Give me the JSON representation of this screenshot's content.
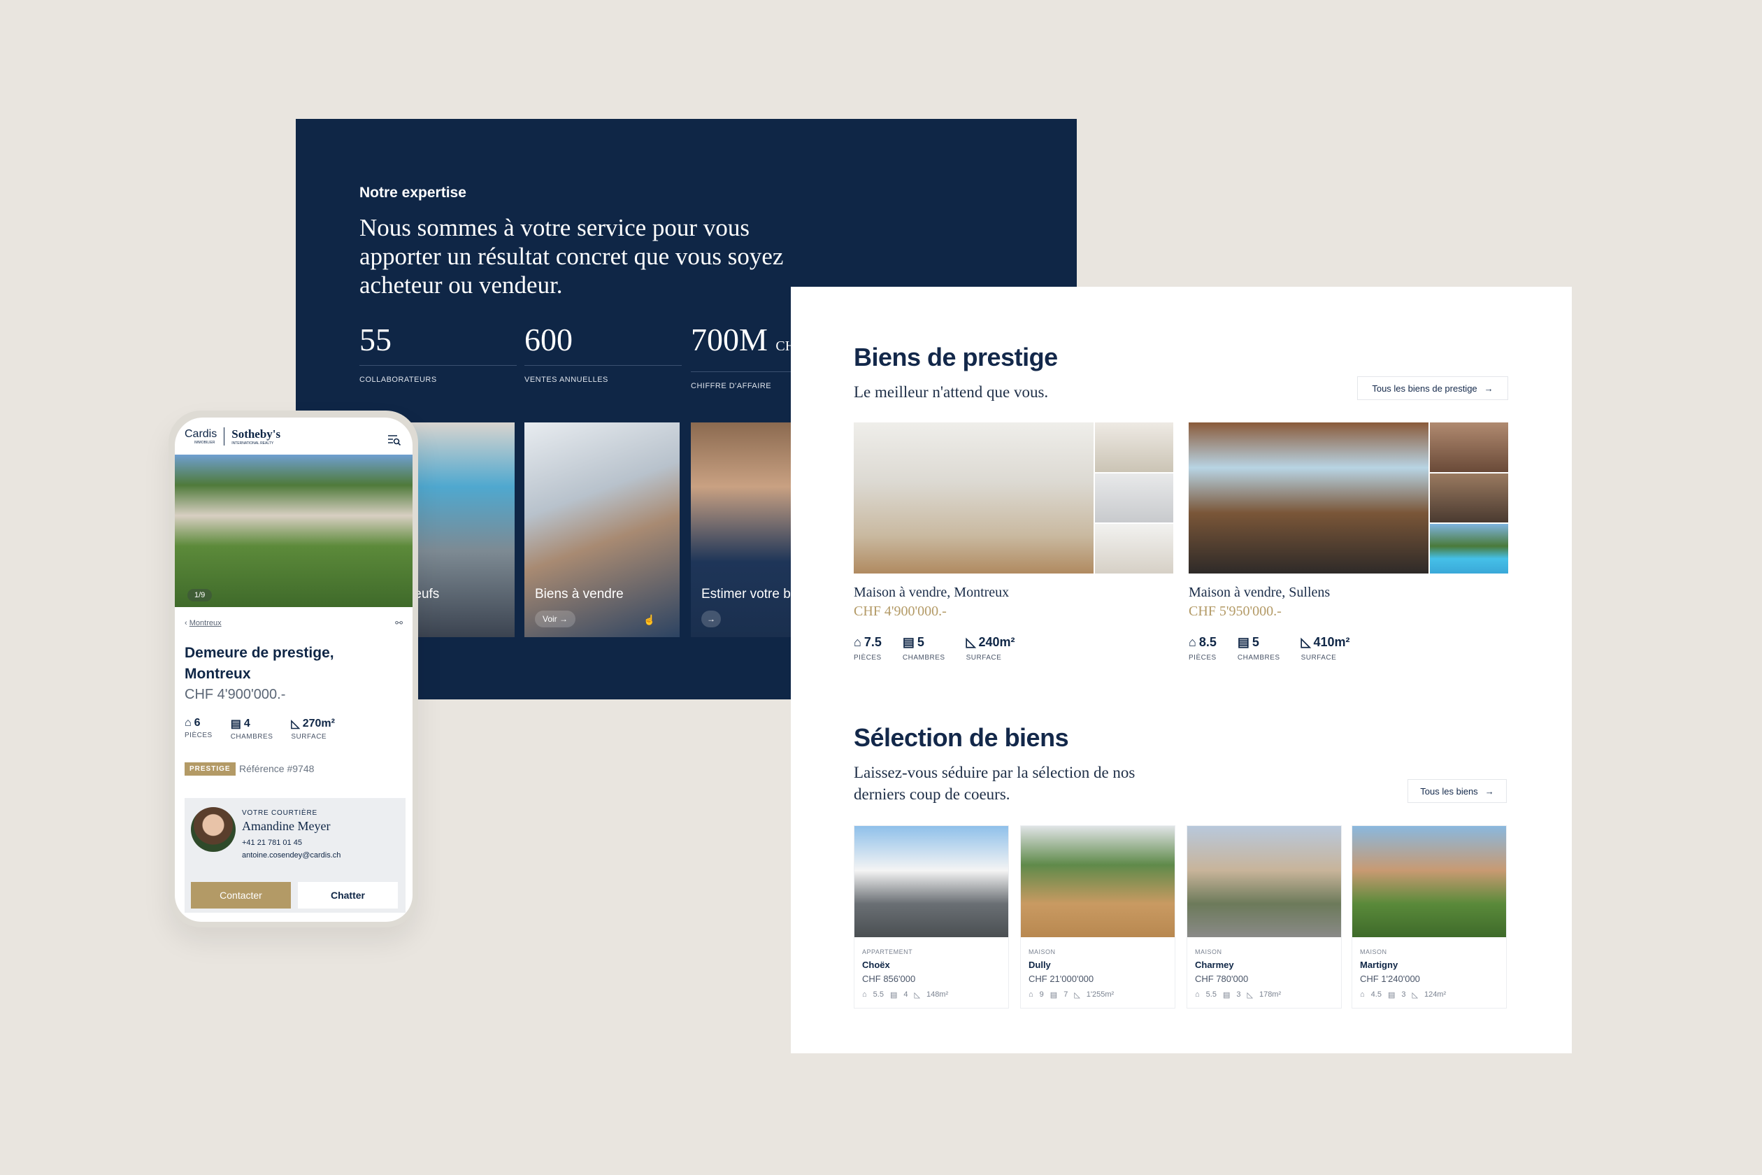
{
  "expertise": {
    "eyebrow": "Notre expertise",
    "heading": "Nous sommes à votre service pour vous apporter un résultat concret que vous soyez acheteur ou vendeur.",
    "stats": [
      {
        "value": "55",
        "unit": "",
        "label": "COLLABORATEURS"
      },
      {
        "value": "600",
        "unit": "",
        "label": "VENTES ANNUELLES"
      },
      {
        "value": "700M",
        "unit": "CHF",
        "label": "CHIFFRE D'AFFAIRE"
      }
    ],
    "services": [
      {
        "title": "Biens neufs",
        "button": ""
      },
      {
        "title": "Biens à vendre",
        "button": "Voir →"
      },
      {
        "title": "Estimer votre bien",
        "button": "→"
      }
    ]
  },
  "prestige": {
    "title": "Biens de prestige",
    "subtitle": "Le meilleur n'attend que vous.",
    "button": "Tous les biens de prestige",
    "items": [
      {
        "title": "Maison à vendre, Montreux",
        "price": "CHF 4'900'000.-",
        "rooms": "7.5",
        "bedrooms": "5",
        "surface": "240m²"
      },
      {
        "title": "Maison à vendre, Sullens",
        "price": "CHF 5'950'000.-",
        "rooms": "8.5",
        "bedrooms": "5",
        "surface": "410m²"
      }
    ],
    "labels": {
      "rooms": "PIÈCES",
      "bedrooms": "CHAMBRES",
      "surface": "SURFACE"
    }
  },
  "selection": {
    "title": "Sélection de biens",
    "subtitle_line1": "Laissez-vous séduire par la sélection de nos",
    "subtitle_line2": "derniers coup de coeurs.",
    "button": "Tous les biens",
    "items": [
      {
        "type": "APPARTEMENT",
        "name": "Choëx",
        "price": "CHF 856'000",
        "rooms": "5.5",
        "bedrooms": "4",
        "surface": "148m²"
      },
      {
        "type": "MAISON",
        "name": "Dully",
        "price": "CHF 21'000'000",
        "rooms": "9",
        "bedrooms": "7",
        "surface": "1'255m²"
      },
      {
        "type": "MAISON",
        "name": "Charmey",
        "price": "CHF 780'000",
        "rooms": "5.5",
        "bedrooms": "3",
        "surface": "178m²"
      },
      {
        "type": "MAISON",
        "name": "Martigny",
        "price": "CHF 1'240'000",
        "rooms": "4.5",
        "bedrooms": "3",
        "surface": "124m²"
      }
    ]
  },
  "mobile": {
    "logo_left": "Cardis",
    "logo_left_sub": "IMMOBILIER",
    "logo_right": "Sotheby's",
    "logo_right_sub": "INTERNATIONAL REALTY",
    "photo_counter": "1/9",
    "breadcrumb": "Montreux",
    "title_line1": "Demeure de prestige,",
    "title_line2": "Montreux",
    "price": "CHF 4'900'000.-",
    "rooms": "6",
    "bedrooms": "4",
    "surface": "270m²",
    "labels": {
      "rooms": "PIÈCES",
      "bedrooms": "CHAMBRES",
      "surface": "SURFACE"
    },
    "badge": "PRESTIGE",
    "reference": "Référence #9748",
    "agent": {
      "role": "VOTRE COURTIÈRE",
      "name": "Amandine Meyer",
      "phone": "+41 21 781 01 45",
      "email": "antoine.cosendey@cardis.ch"
    },
    "contact_button": "Contacter",
    "chat_button": "Chatter"
  },
  "colors": {
    "navy": "#0f2646",
    "gold": "#b39a66",
    "background": "#e9e5df"
  }
}
